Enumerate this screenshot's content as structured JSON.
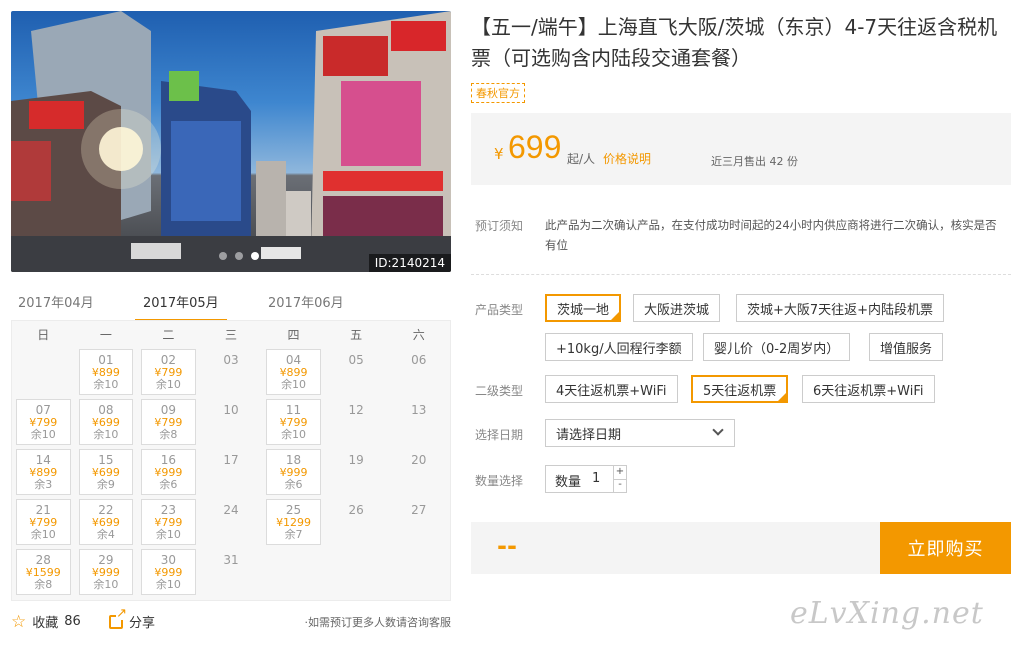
{
  "product": {
    "title": "【五一/端午】上海直飞大阪/茨城（东京）4-7天往返含税机票（可选购含内陆段交通套餐）",
    "tag": "春秋官方",
    "image_id": "ID:2140214"
  },
  "price": {
    "currency": "¥",
    "amount": "699",
    "unit": "起/人",
    "explain_link": "价格说明",
    "sold": "近三月售出 42 份"
  },
  "notice": {
    "label": "预订须知",
    "text": "此产品为二次确认产品，在支付成功时间起的24小时内供应商将进行二次确认，核实是否有位"
  },
  "product_type": {
    "label": "产品类型",
    "options": [
      "茨城一地",
      "大阪进茨城",
      "茨城+大阪7天往返+内陆段机票",
      "+10kg/人回程行李额",
      "婴儿价（0-2周岁内）",
      "增值服务"
    ],
    "selected_index": 0
  },
  "secondary_type": {
    "label": "二级类型",
    "options": [
      "4天往返机票+WiFi",
      "5天往返机票",
      "6天往返机票+WiFi"
    ],
    "selected_index": 1
  },
  "date_select": {
    "label": "选择日期",
    "value": "请选择日期"
  },
  "quantity": {
    "label": "数量选择",
    "field_label": "数量",
    "value": "1",
    "plus": "+",
    "minus": "-"
  },
  "buy": {
    "total": "--",
    "button": "立即购买"
  },
  "calendar": {
    "months": [
      "2017年04月",
      "2017年05月",
      "2017年06月"
    ],
    "active_month_index": 1,
    "weekdays": [
      "日",
      "一",
      "二",
      "三",
      "四",
      "五",
      "六"
    ],
    "leading_blanks": 1,
    "days": [
      {
        "d": "01",
        "p": "¥899",
        "r": "余10"
      },
      {
        "d": "02",
        "p": "¥799",
        "r": "余10"
      },
      {
        "d": "03"
      },
      {
        "d": "04",
        "p": "¥899",
        "r": "余10"
      },
      {
        "d": "05"
      },
      {
        "d": "06"
      },
      {
        "d": "07",
        "p": "¥799",
        "r": "余10"
      },
      {
        "d": "08",
        "p": "¥699",
        "r": "余10"
      },
      {
        "d": "09",
        "p": "¥799",
        "r": "余8"
      },
      {
        "d": "10"
      },
      {
        "d": "11",
        "p": "¥799",
        "r": "余10"
      },
      {
        "d": "12"
      },
      {
        "d": "13"
      },
      {
        "d": "14",
        "p": "¥899",
        "r": "余3"
      },
      {
        "d": "15",
        "p": "¥699",
        "r": "余9"
      },
      {
        "d": "16",
        "p": "¥999",
        "r": "余6"
      },
      {
        "d": "17"
      },
      {
        "d": "18",
        "p": "¥999",
        "r": "余6"
      },
      {
        "d": "19"
      },
      {
        "d": "20"
      },
      {
        "d": "21",
        "p": "¥799",
        "r": "余10"
      },
      {
        "d": "22",
        "p": "¥699",
        "r": "余4"
      },
      {
        "d": "23",
        "p": "¥799",
        "r": "余10"
      },
      {
        "d": "24"
      },
      {
        "d": "25",
        "p": "¥1299",
        "r": "余7"
      },
      {
        "d": "26"
      },
      {
        "d": "27"
      },
      {
        "d": "28",
        "p": "¥1599",
        "r": "余8"
      },
      {
        "d": "29",
        "p": "¥999",
        "r": "余10"
      },
      {
        "d": "30",
        "p": "¥999",
        "r": "余10"
      },
      {
        "d": "31"
      }
    ]
  },
  "footer": {
    "favorite_label": "收藏",
    "favorite_count": "86",
    "share_label": "分享",
    "note": "·如需预订更多人数请咨询客服"
  },
  "watermark": "eLvXing.net",
  "colors": {
    "accent": "#f39800",
    "panel": "#f4f4f4"
  }
}
